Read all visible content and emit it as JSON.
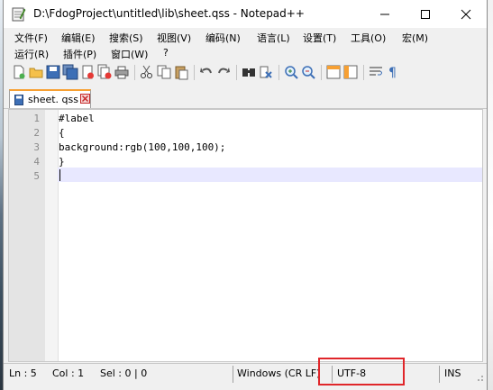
{
  "window": {
    "title": "D:\\FdogProject\\untitled\\lib\\sheet.qss - Notepad++"
  },
  "menu": {
    "row1": [
      "文件(F)",
      "编辑(E)",
      "搜索(S)",
      "视图(V)",
      "编码(N)",
      "语言(L)",
      "设置(T)",
      "工具(O)",
      "宏(M)"
    ],
    "row2": [
      "运行(R)",
      "插件(P)",
      "窗口(W)",
      "?"
    ]
  },
  "toolbar": {
    "icons": [
      "new-file-icon",
      "open-file-icon",
      "save-icon",
      "save-all-icon",
      "close-icon",
      "close-all-icon",
      "print-icon",
      "cut-icon",
      "copy-icon",
      "paste-icon",
      "undo-icon",
      "redo-icon",
      "find-icon",
      "replace-icon",
      "zoom-in-icon",
      "zoom-out-icon",
      "sync-vertical-icon",
      "sync-horizontal-icon",
      "word-wrap-icon",
      "show-all-chars-icon"
    ]
  },
  "tab": {
    "label": "sheet. qss"
  },
  "editor": {
    "line_numbers": [
      "1",
      "2",
      "3",
      "4",
      "5"
    ],
    "lines": [
      "#label",
      "{",
      "background:rgb(100,100,100);",
      "}",
      ""
    ]
  },
  "status": {
    "ln": "Ln : 5",
    "col": "Col : 1",
    "sel": "Sel : 0 | 0",
    "eol": "Windows (CR LF)",
    "encoding": "UTF-8",
    "mode": "INS"
  },
  "colors": {
    "accent_tab": "#f7a033",
    "highlight_box": "#e0262a",
    "current_line": "#e8e8ff"
  }
}
